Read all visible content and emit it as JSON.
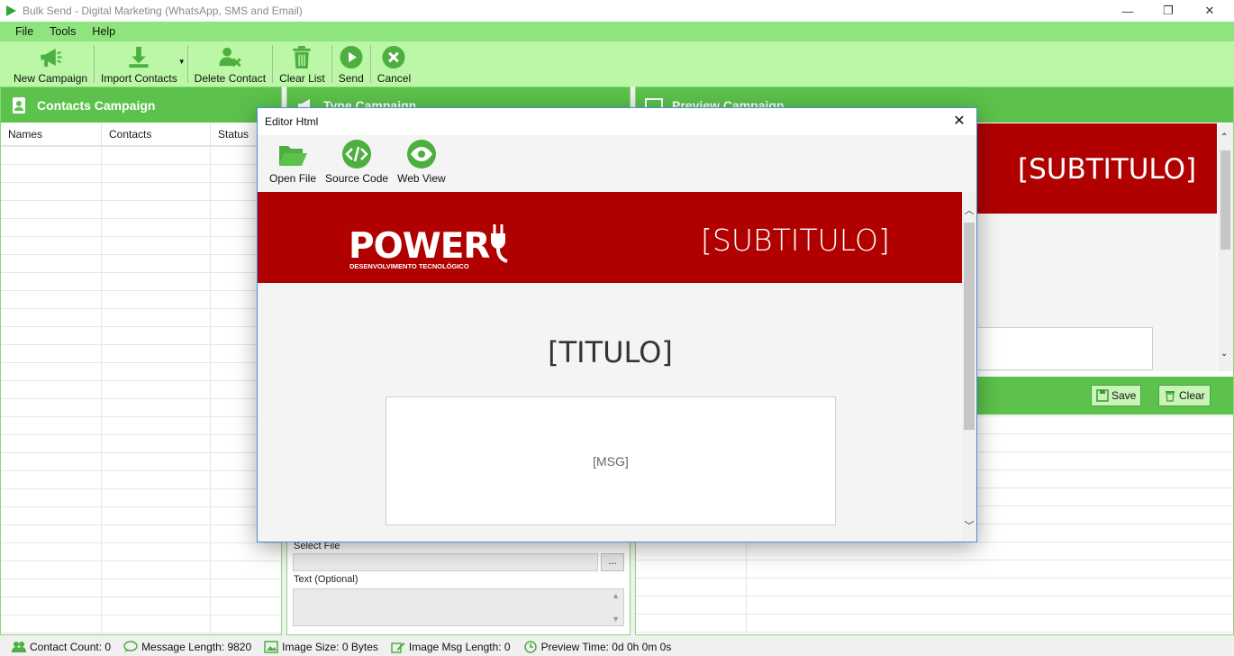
{
  "window": {
    "title": "Bulk Send - Digital Marketing (WhatsApp, SMS and Email)"
  },
  "menu": [
    "File",
    "Tools",
    "Help"
  ],
  "toolbar": {
    "new_campaign": "New Campaign",
    "import_contacts": "Import Contacts",
    "delete_contact": "Delete Contact",
    "clear_list": "Clear List",
    "send": "Send",
    "cancel": "Cancel"
  },
  "contacts_panel": {
    "title": "Contacts Campaign",
    "columns": [
      "Names",
      "Contacts",
      "Status"
    ]
  },
  "type_panel": {
    "title": "Type Campaign",
    "select_file_label": "Select File",
    "browse_label": "...",
    "text_optional_label": "Text (Optional)"
  },
  "preview_panel": {
    "title": "Preview Campaign",
    "subtitle_placeholder": "[SUBTITULO]",
    "partial_text": "]",
    "save_label": "Save",
    "clear_label": "Clear"
  },
  "dialog": {
    "title": "Editor Html",
    "close": "✕",
    "open_file": "Open File",
    "source_code": "Source Code",
    "web_view": "Web View",
    "content": {
      "logo_text": "POWER",
      "logo_tagline": "DESENVOLVIMENTO TECNOLÓGICO",
      "subtitle": "[SUBTITULO]",
      "title": "[TITULO]",
      "msg": "[MSG]"
    }
  },
  "statusbar": {
    "contact_count": "Contact Count: 0",
    "message_length": "Message Length: 9820",
    "image_size": "Image Size: 0 Bytes",
    "image_msg_length": "Image Msg Length: 0",
    "preview_time": "Preview Time: 0d 0h 0m 0s"
  },
  "colors": {
    "menu_green": "#8fe57d",
    "toolbar_green": "#bbf7a6",
    "header_green": "#5cc24b",
    "banner_red": "#b00000"
  }
}
